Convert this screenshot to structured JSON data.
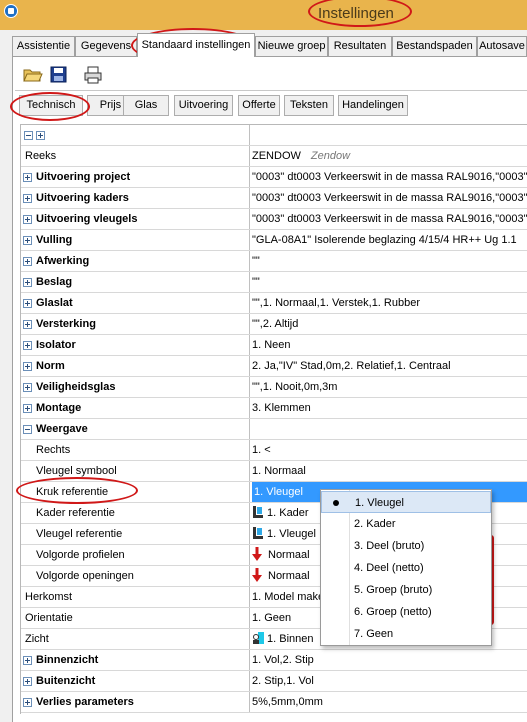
{
  "window": {
    "title": "Instellingen"
  },
  "tabs": [
    {
      "label": "Assistentie"
    },
    {
      "label": "Gegevens"
    },
    {
      "label": "Standaard instellingen"
    },
    {
      "label": "Nieuwe groep"
    },
    {
      "label": "Resultaten"
    },
    {
      "label": "Bestandspaden"
    },
    {
      "label": "Autosave"
    }
  ],
  "toolbar": {
    "open_icon": "folder-open-icon",
    "save_icon": "save-icon",
    "print_icon": "printer-icon"
  },
  "subtabs": [
    {
      "label": "Technisch"
    },
    {
      "label": "Prijs"
    },
    {
      "label": "Glas"
    },
    {
      "label": "Uitvoering"
    },
    {
      "label": "Offerte"
    },
    {
      "label": "Teksten"
    },
    {
      "label": "Handelingen"
    }
  ],
  "grid": {
    "rows": [
      {
        "label": "Reeks",
        "value": "ZENDOW",
        "extra": "Zendow"
      },
      {
        "label": "Uitvoering project",
        "value": "\"0003\" dt0003 Verkeerswit in de massa RAL9016,\"0003\""
      },
      {
        "label": "Uitvoering kaders",
        "value": "\"0003\" dt0003 Verkeerswit in de massa RAL9016,\"0003\""
      },
      {
        "label": "Uitvoering vleugels",
        "value": "\"0003\" dt0003 Verkeerswit in de massa RAL9016,\"0003\""
      },
      {
        "label": "Vulling",
        "value": "\"GLA-08A1\" Isolerende beglazing  4/15/4  HR++  Ug 1.1"
      },
      {
        "label": "Afwerking",
        "value": "\"\""
      },
      {
        "label": "Beslag",
        "value": "\"\""
      },
      {
        "label": "Glaslat",
        "value": "\"\",1. Normaal,1. Verstek,1. Rubber"
      },
      {
        "label": "Versterking",
        "value": "\"\",2. Altijd"
      },
      {
        "label": "Isolator",
        "value": "1. Neen"
      },
      {
        "label": "Norm",
        "value": "2. Ja,\"IV\" Stad,0m,2. Relatief,1. Centraal"
      },
      {
        "label": "Veiligheidsglas",
        "value": "\"\",1. Nooit,0m,3m"
      },
      {
        "label": "Montage",
        "value": "3. Klemmen"
      },
      {
        "label": "Weergave",
        "value": ""
      },
      {
        "label": "Rechts",
        "value": "1. <"
      },
      {
        "label": "Vleugel symbool",
        "value": "1. Normaal"
      },
      {
        "label": "Kruk referentie",
        "value": "1. Vleugel"
      },
      {
        "label": "Kader referentie",
        "value": "1. Kader"
      },
      {
        "label": "Vleugel referentie",
        "value": "1. Vleugel"
      },
      {
        "label": "Volgorde profielen",
        "value": "Normaal"
      },
      {
        "label": "Volgorde openingen",
        "value": "Normaal"
      },
      {
        "label": "Herkomst",
        "value": "1. Model maker"
      },
      {
        "label": "Orientatie",
        "value": "1. Geen"
      },
      {
        "label": "Zicht",
        "value": "1. Binnen"
      },
      {
        "label": "Binnenzicht",
        "value": "1. Vol,2. Stip"
      },
      {
        "label": "Buitenzicht",
        "value": "2. Stip,1. Vol"
      },
      {
        "label": "Verlies parameters",
        "value": "5%,5mm,0mm"
      }
    ]
  },
  "dropdown": {
    "options": [
      {
        "label": "1. Vleugel"
      },
      {
        "label": "2. Kader"
      },
      {
        "label": "3. Deel (bruto)"
      },
      {
        "label": "4. Deel (netto)"
      },
      {
        "label": "5. Groep (bruto)"
      },
      {
        "label": "6. Groep (netto)"
      },
      {
        "label": "7. Geen"
      }
    ],
    "selected": "1. Vleugel"
  },
  "colors": {
    "highlight": "#d01818",
    "selection": "#3399ff",
    "titlebar": "#e9b44c"
  }
}
